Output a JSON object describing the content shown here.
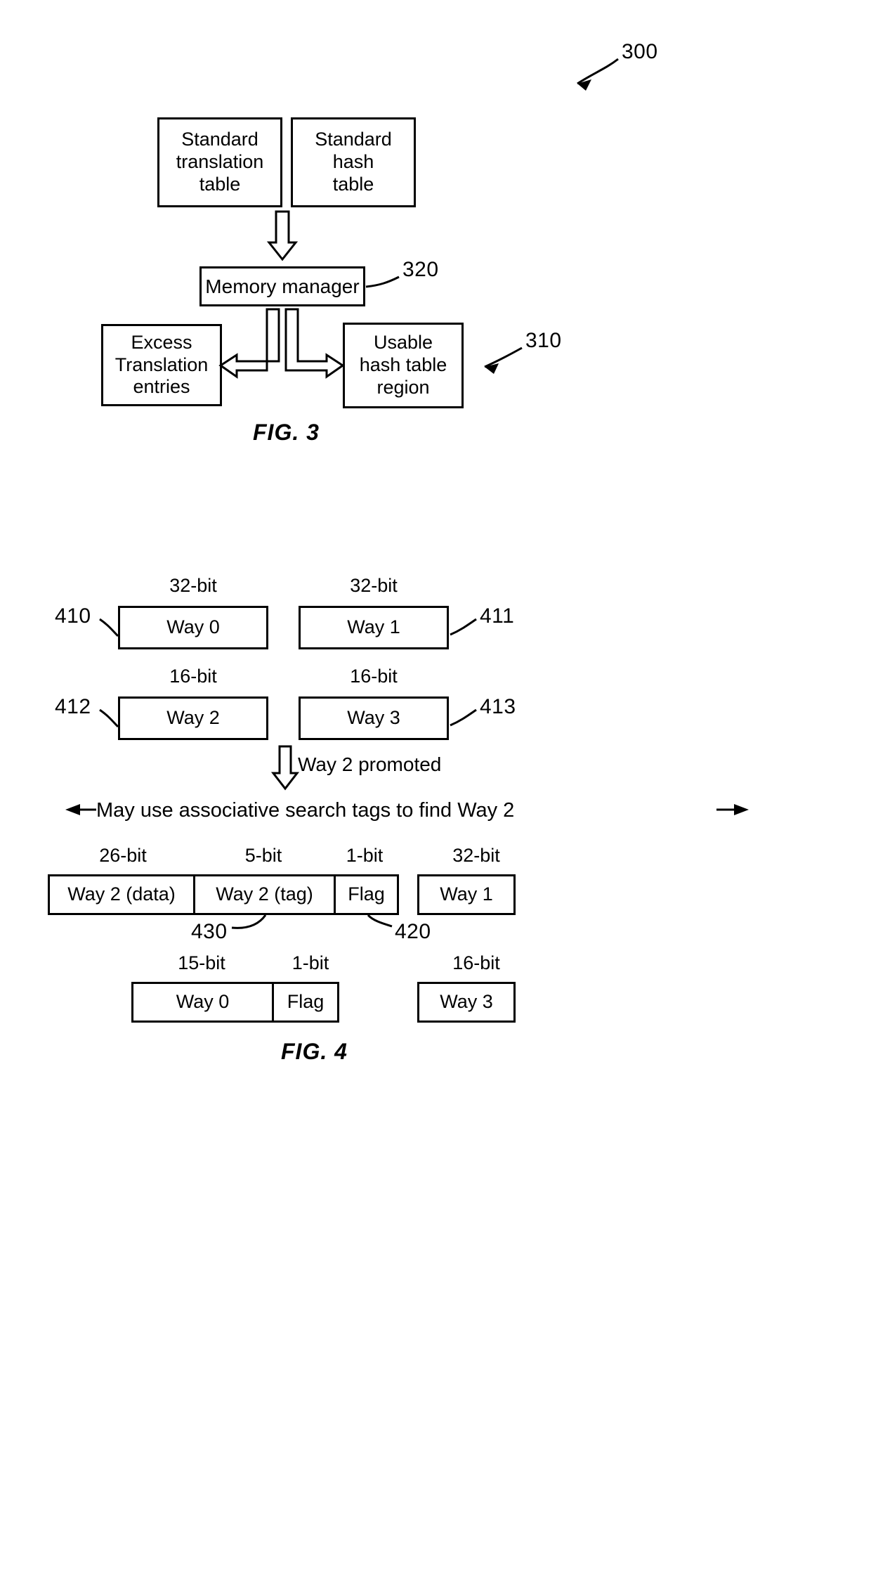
{
  "document": {
    "type": "patent-drawing-sheet",
    "figures": [
      "FIG. 3",
      "FIG. 4"
    ]
  },
  "fig3": {
    "caption": "FIG. 3",
    "ref_300": "300",
    "ref_320": "320",
    "ref_310": "310",
    "boxes": {
      "standard_translation_table": "Standard\ntranslation\ntable",
      "standard_translation_table_lines": [
        "Standard",
        "translation",
        "table"
      ],
      "standard_hash_table_lines": [
        "Standard",
        "hash",
        "table"
      ],
      "memory_manager": "Memory manager",
      "excess_translation_entries_lines": [
        "Excess",
        "Translation",
        "entries"
      ],
      "usable_hash_table_region_lines": [
        "Usable",
        "hash table",
        "region"
      ]
    }
  },
  "fig4": {
    "caption": "FIG. 4",
    "promotion_note": "Way 2 promoted",
    "associative_note": "May use associative search tags to find Way 2",
    "row1": [
      {
        "ref": "410",
        "bits": "32-bit",
        "label": "Way 0"
      },
      {
        "ref": "411",
        "bits": "32-bit",
        "label": "Way 1"
      }
    ],
    "row2": [
      {
        "ref": "412",
        "bits": "16-bit",
        "label": "Way 2"
      },
      {
        "ref": "413",
        "bits": "16-bit",
        "label": "Way 3"
      }
    ],
    "row3": [
      {
        "bits": "26-bit",
        "label": "Way 2 (data)"
      },
      {
        "bits": "5-bit",
        "label": "Way 2 (tag)",
        "ref": "430"
      },
      {
        "bits": "1-bit",
        "label": "Flag",
        "ref": "420"
      },
      {
        "bits": "32-bit",
        "label": "Way 1"
      }
    ],
    "row4": [
      {
        "bits": "15-bit",
        "label": "Way 0"
      },
      {
        "bits": "1-bit",
        "label": "Flag"
      },
      {
        "bits": "16-bit",
        "label": "Way 3"
      }
    ]
  }
}
